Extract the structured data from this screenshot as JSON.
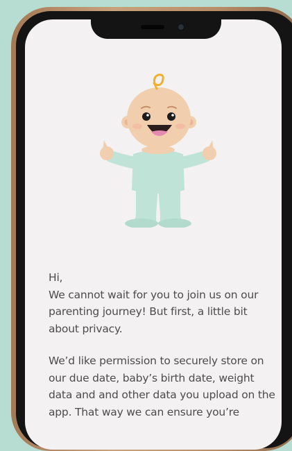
{
  "intro": {
    "greeting": "Hi,",
    "message": "We cannot wait for you to join us on our parenting journey! But first, a little bit about privacy.",
    "permission": "We’d like permission to securely store on our due date, baby’s birth date, weight data and and other data you upload on the app. That way we can ensure you’re"
  },
  "colors": {
    "background": "#b7ddd2",
    "screen": "#f3f1f1",
    "onesie": "#bfe3d6",
    "skin": "#f1cfae",
    "text": "#4c4c4c"
  },
  "icons": {
    "illustration": "baby-illustration"
  }
}
